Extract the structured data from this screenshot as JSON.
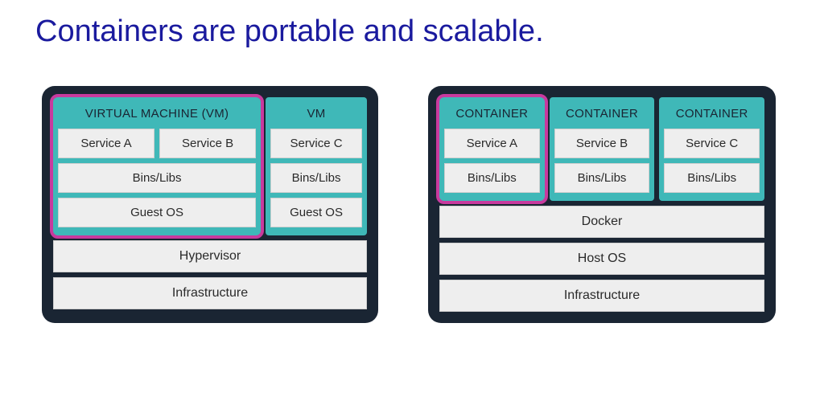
{
  "title": "Containers are portable and scalable.",
  "colors": {
    "panel_bg": "#1a2533",
    "teal": "#3fb8b8",
    "highlight": "#c83a9e",
    "cell_bg": "#eeeeee",
    "title_color": "#1a1a9e"
  },
  "left_panel": {
    "vms": [
      {
        "label": "VIRTUAL MACHINE (VM)",
        "highlighted": true,
        "services": [
          "Service A",
          "Service B"
        ],
        "bins": "Bins/Libs",
        "os": "Guest OS"
      },
      {
        "label": "VM",
        "highlighted": false,
        "services": [
          "Service C"
        ],
        "bins": "Bins/Libs",
        "os": "Guest OS"
      }
    ],
    "base_layers": [
      "Hypervisor",
      "Infrastructure"
    ]
  },
  "right_panel": {
    "containers": [
      {
        "label": "CONTAINER",
        "highlighted": true,
        "service": "Service A",
        "bins": "Bins/Libs"
      },
      {
        "label": "CONTAINER",
        "highlighted": false,
        "service": "Service B",
        "bins": "Bins/Libs"
      },
      {
        "label": "CONTAINER",
        "highlighted": false,
        "service": "Service C",
        "bins": "Bins/Libs"
      }
    ],
    "base_layers": [
      "Docker",
      "Host OS",
      "Infrastructure"
    ]
  }
}
